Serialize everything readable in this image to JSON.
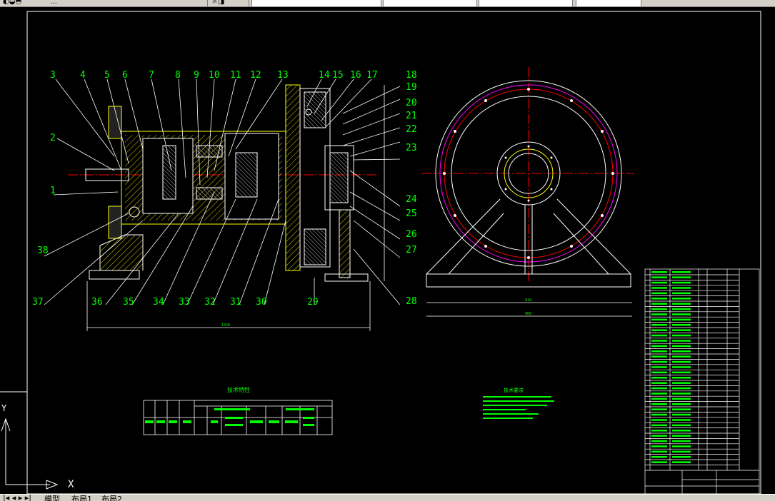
{
  "app": {
    "toolbar_title": "…",
    "tabs": [
      "模型",
      "布局1",
      "布局2"
    ]
  },
  "drawing": {
    "part_labels_top": [
      "3",
      "4",
      "5",
      "6",
      "7",
      "8",
      "9",
      "10",
      "11",
      "12",
      "13",
      "14",
      "15",
      "16",
      "17"
    ],
    "part_labels_right": [
      "18",
      "19",
      "20",
      "21",
      "22",
      "23",
      "24",
      "25",
      "26",
      "27",
      "28"
    ],
    "part_labels_left": [
      "2",
      "1",
      "38",
      "37"
    ],
    "part_labels_bottom": [
      "36",
      "35",
      "34",
      "33",
      "32",
      "31",
      "30",
      "29"
    ],
    "tech_spec_title": "技术特性",
    "tech_req_title": "技术要求",
    "ucs_x": "X",
    "ucs_y": "Y",
    "dims": {
      "overall": "1320",
      "width": "910",
      "base": "960"
    },
    "colors": {
      "green": "#00ff00",
      "yellow": "#ffff00",
      "white": "#ffffff",
      "red": "#ff0000",
      "magenta": "#ff00ff",
      "cyan": "#00ffff"
    }
  }
}
